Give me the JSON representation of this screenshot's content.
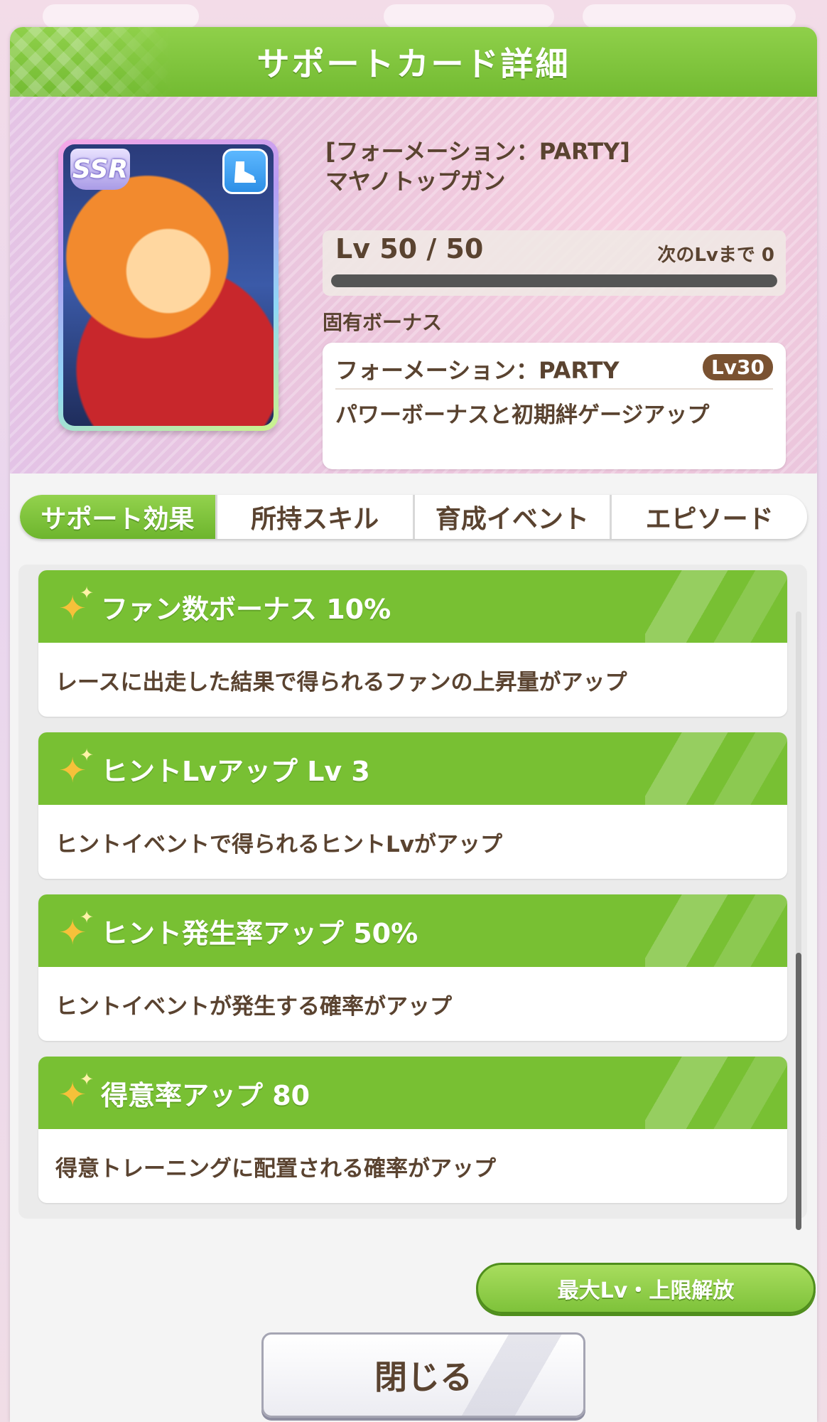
{
  "header": {
    "title": "サポートカード詳細"
  },
  "card": {
    "rarity": "SSR",
    "type_icon": "shoe-icon",
    "name_line1": "[フォーメーション：PARTY]",
    "name_line2": "マヤノトップガン"
  },
  "level": {
    "label": "Lv 50 / 50",
    "next_label": "次のLvまで 0",
    "progress": 1.0
  },
  "unique_bonus": {
    "label": "固有ボーナス",
    "title": "フォーメーション：PARTY",
    "level_badge": "Lv30",
    "description": "パワーボーナスと初期絆ゲージアップ"
  },
  "tabs": [
    {
      "label": "サポート効果",
      "active": true
    },
    {
      "label": "所持スキル",
      "active": false
    },
    {
      "label": "育成イベント",
      "active": false
    },
    {
      "label": "エピソード",
      "active": false
    }
  ],
  "effects": [
    {
      "title": "ファン数ボーナス 10%",
      "description": "レースに出走した結果で得られるファンの上昇量がアップ"
    },
    {
      "title": "ヒントLvアップ Lv 3",
      "description": "ヒントイベントで得られるヒントLvがアップ"
    },
    {
      "title": "ヒント発生率アップ 50%",
      "description": "ヒントイベントが発生する確率がアップ"
    },
    {
      "title": "得意率アップ 80",
      "description": "得意トレーニングに配置される確率がアップ"
    }
  ],
  "buttons": {
    "max_level": "最大Lv・上限解放",
    "close": "閉じる"
  },
  "colors": {
    "accent_green": "#78c033",
    "text_brown": "#5a4330",
    "badge_brown": "#7a5231"
  }
}
